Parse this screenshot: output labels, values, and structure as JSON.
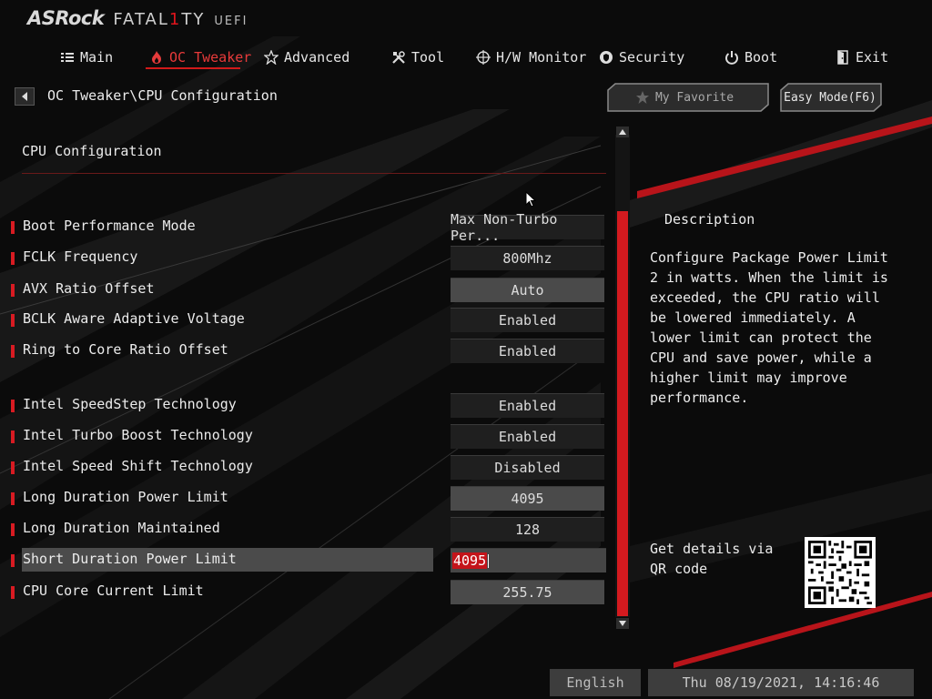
{
  "brand": {
    "name": "ASRock",
    "line": "FATAL1TY",
    "line_pre": "FATAL",
    "line_one": "1",
    "line_post": "TY",
    "suffix": "UEFI"
  },
  "nav": [
    {
      "label": "Main",
      "icon": "list-icon",
      "active": false
    },
    {
      "label": "OC Tweaker",
      "icon": "flame-icon",
      "active": true
    },
    {
      "label": "Advanced",
      "icon": "star-icon",
      "active": false
    },
    {
      "label": "Tool",
      "icon": "tools-icon",
      "active": false
    },
    {
      "label": "H/W Monitor",
      "icon": "crosshair-icon",
      "active": false
    },
    {
      "label": "Security",
      "icon": "shield-icon",
      "active": false
    },
    {
      "label": "Boot",
      "icon": "power-icon",
      "active": false
    },
    {
      "label": "Exit",
      "icon": "exit-door-icon",
      "active": false
    }
  ],
  "breadcrumb": "OC Tweaker\\CPU Configuration",
  "favorite_button": "My Favorite",
  "easy_mode_button": "Easy Mode(F6)",
  "section_title": "CPU Configuration",
  "settings": [
    {
      "label": "Boot Performance Mode",
      "value": "Max Non-Turbo Per..."
    },
    {
      "label": "FCLK Frequency",
      "value": "800Mhz"
    },
    {
      "label": "AVX Ratio Offset",
      "value": "Auto"
    },
    {
      "label": "BCLK Aware Adaptive Voltage",
      "value": "Enabled"
    },
    {
      "label": "Ring to Core Ratio Offset",
      "value": "Enabled"
    },
    {
      "label": "Intel SpeedStep Technology",
      "value": "Enabled"
    },
    {
      "label": "Intel Turbo Boost Technology",
      "value": "Enabled"
    },
    {
      "label": "Intel Speed Shift Technology",
      "value": "Disabled"
    },
    {
      "label": "Long Duration Power Limit",
      "value": "4095"
    },
    {
      "label": "Long Duration Maintained",
      "value": "128"
    },
    {
      "label": "Short Duration Power Limit",
      "value": "4095",
      "selected": true
    },
    {
      "label": "CPU Core Current Limit",
      "value": "255.75"
    }
  ],
  "description": {
    "title": "Description",
    "text": "Configure Package Power Limit 2 in watts. When the limit is exceeded, the CPU ratio will be lowered immediately. A lower limit can protect the CPU and save power, while a higher limit may improve performance.",
    "qr_text": "Get details via QR code"
  },
  "footer": {
    "language": "English",
    "datetime": "Thu 08/19/2021, 14:16:46"
  },
  "colors": {
    "accent": "#d41a1f",
    "background": "#0b0b0b",
    "text": "#ececec"
  }
}
